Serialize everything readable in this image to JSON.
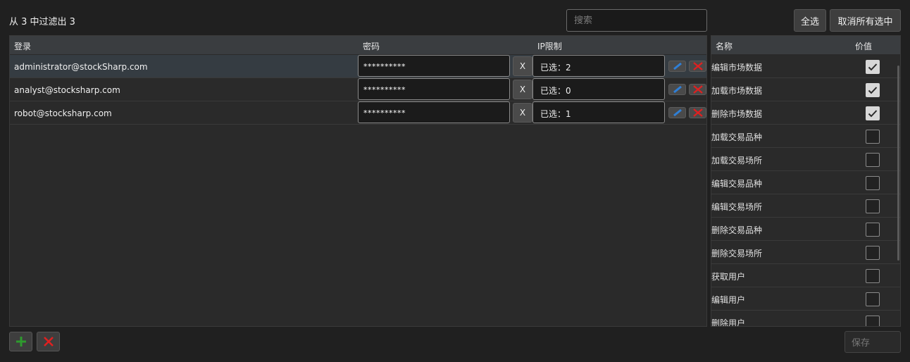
{
  "header": {
    "filter_summary": "从 3 中过滤出 3",
    "search_placeholder": "搜索",
    "select_all_label": "全选",
    "deselect_all_label": "取消所有选中"
  },
  "users_grid": {
    "columns": [
      "登录",
      "密码",
      "IP限制"
    ],
    "rows": [
      {
        "login": "administrator@stockSharp.com",
        "password": "**********",
        "clear_label": "X",
        "ip": "已选：2",
        "selected": true
      },
      {
        "login": "analyst@stocksharp.com",
        "password": "**********",
        "clear_label": "X",
        "ip": "已选：0",
        "selected": false
      },
      {
        "login": "robot@stocksharp.com",
        "password": "**********",
        "clear_label": "X",
        "ip": "已选：1",
        "selected": false
      }
    ]
  },
  "permissions_grid": {
    "columns": [
      "名称",
      "价值"
    ],
    "rows": [
      {
        "name": "编辑市场数据",
        "checked": true
      },
      {
        "name": "加载市场数据",
        "checked": true
      },
      {
        "name": "删除市场数据",
        "checked": true
      },
      {
        "name": "加载交易品种",
        "checked": false
      },
      {
        "name": "加载交易场所",
        "checked": false
      },
      {
        "name": "编辑交易品种",
        "checked": false
      },
      {
        "name": "编辑交易场所",
        "checked": false
      },
      {
        "name": "删除交易品种",
        "checked": false
      },
      {
        "name": "删除交易场所",
        "checked": false
      },
      {
        "name": "获取用户",
        "checked": false
      },
      {
        "name": "编辑用户",
        "checked": false
      },
      {
        "name": "删除用户",
        "checked": false
      }
    ]
  },
  "footer": {
    "save_label": "保存"
  },
  "colors": {
    "add_icon": "#2e9b2e",
    "delete_icon": "#e02020",
    "edit_icon": "#2f7fd6"
  },
  "icons": {
    "add": "plus-icon",
    "delete": "x-icon",
    "edit": "pencil-icon",
    "check": "check-icon"
  }
}
